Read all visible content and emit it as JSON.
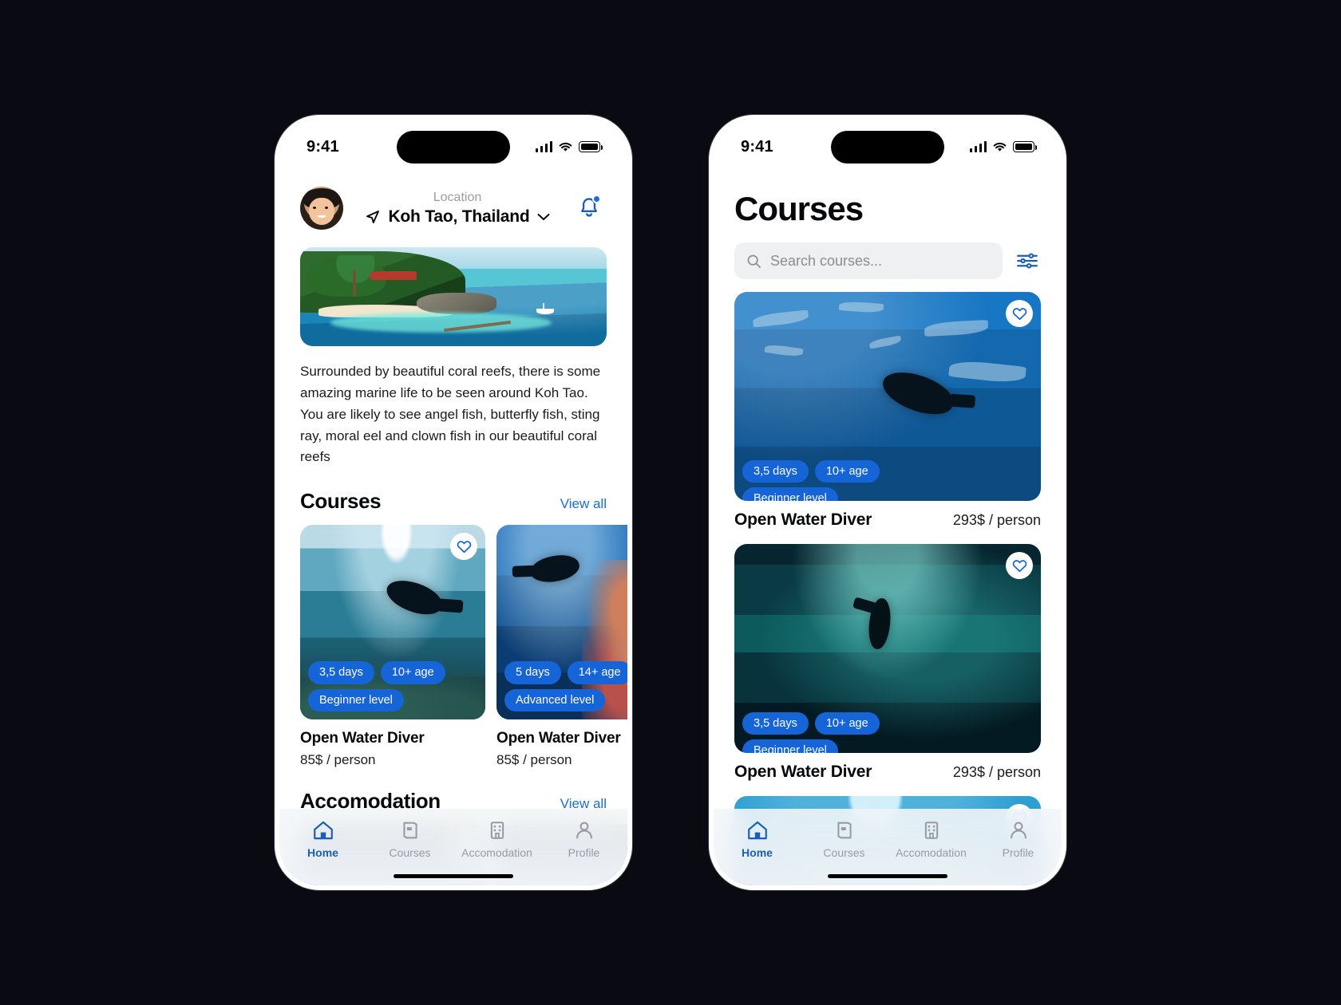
{
  "status_bar": {
    "time": "9:41",
    "cellular_icon": "signal-bars-icon",
    "wifi_icon": "wifi-icon",
    "battery_icon": "battery-icon"
  },
  "home_screen": {
    "header": {
      "avatar_name": "user-avatar",
      "location_label": "Location",
      "location_value": "Koh Tao, Thailand",
      "location_pin_icon": "navigation-arrow-icon",
      "chevron_icon": "chevron-down-icon",
      "notification_icon": "bell-icon"
    },
    "hero_image_alt": "koh-tao-beach-photo",
    "description": "Surrounded by beautiful coral reefs, there is some amazing marine life to be seen around Koh Tao. You are likely to see angel fish, butterfly fish, sting ray, moral eel and clown fish in our beautiful coral reefs",
    "sections": [
      {
        "title": "Courses",
        "link": "View all",
        "cards": [
          {
            "name": "Open Water Diver",
            "price": "85$ / person",
            "badges": [
              "3,5 days",
              "10+ age",
              "Beginner level"
            ],
            "favorite_icon": "heart-icon"
          },
          {
            "name": "Open Water Diver",
            "price": "85$ / person",
            "badges": [
              "5 days",
              "14+ age",
              "Advanced level"
            ],
            "favorite_icon": "heart-icon"
          }
        ]
      },
      {
        "title": "Accomodation",
        "link": "View all",
        "cards": []
      }
    ]
  },
  "courses_screen": {
    "title": "Courses",
    "search": {
      "placeholder": "Search courses...",
      "value": "",
      "search_icon": "search-icon",
      "filter_icon": "sliders-filter-icon"
    },
    "cards": [
      {
        "name": "Open Water Diver",
        "price": "293$ / person",
        "badges": [
          "3,5 days",
          "10+ age",
          "Beginner level"
        ],
        "favorite_icon": "heart-icon",
        "image_alt": "diver-with-sharks-photo"
      },
      {
        "name": "Open Water Diver",
        "price": "293$ / person",
        "badges": [
          "3,5 days",
          "10+ age",
          "Beginner level"
        ],
        "favorite_icon": "heart-icon",
        "image_alt": "diver-in-deep-water-photo"
      },
      {
        "name": "",
        "price": "",
        "badges": [],
        "favorite_icon": "heart-icon",
        "image_alt": "diver-sunrays-photo"
      }
    ]
  },
  "tab_bar": {
    "items": [
      {
        "label": "Home",
        "icon": "home-icon",
        "active": true
      },
      {
        "label": "Courses",
        "icon": "book-icon",
        "active": false
      },
      {
        "label": "Accomodation",
        "icon": "building-icon",
        "active": false
      },
      {
        "label": "Profile",
        "icon": "person-icon",
        "active": false
      }
    ]
  },
  "colors": {
    "background": "#0a0b12",
    "accent": "#1565d8",
    "active_tab": "#1a5fb4",
    "link": "#1a6ed8",
    "muted_text": "#9a9ba2"
  }
}
